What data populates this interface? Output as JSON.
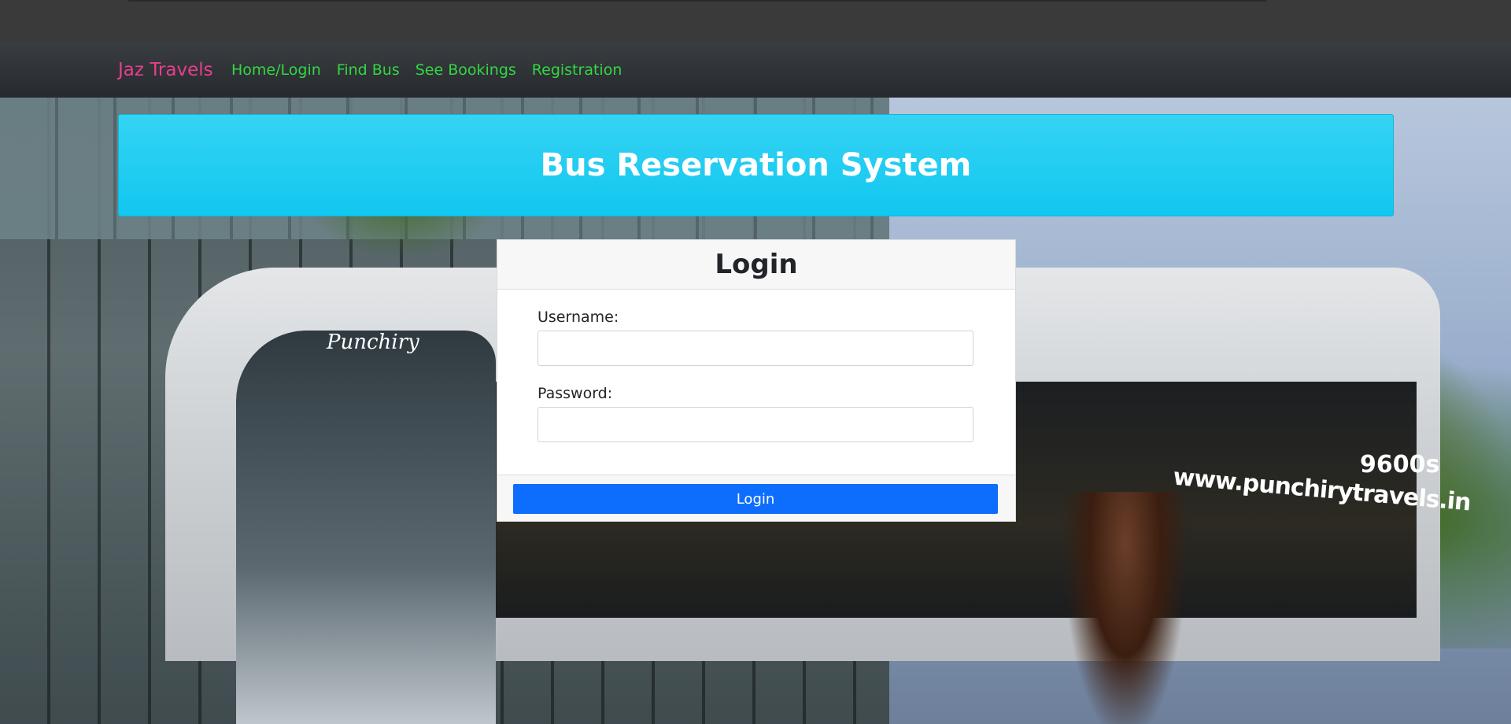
{
  "navbar": {
    "brand": "Jaz Travels",
    "links": [
      {
        "label": "Home/Login"
      },
      {
        "label": "Find Bus"
      },
      {
        "label": "See Bookings"
      },
      {
        "label": "Registration"
      }
    ]
  },
  "banner": {
    "title": "Bus Reservation System"
  },
  "login": {
    "header": "Login",
    "username_label": "Username:",
    "username_value": "",
    "password_label": "Password:",
    "password_value": "",
    "button_label": "Login"
  },
  "background": {
    "bus_logo_text": "Punchiry",
    "bus_url_text": "www.punchirytravels.in",
    "bus_model_text": "9600s"
  },
  "colors": {
    "brand": "#e83e8c",
    "nav_link": "#31d843",
    "banner": "#11c7f0",
    "button": "#0d6efd"
  }
}
